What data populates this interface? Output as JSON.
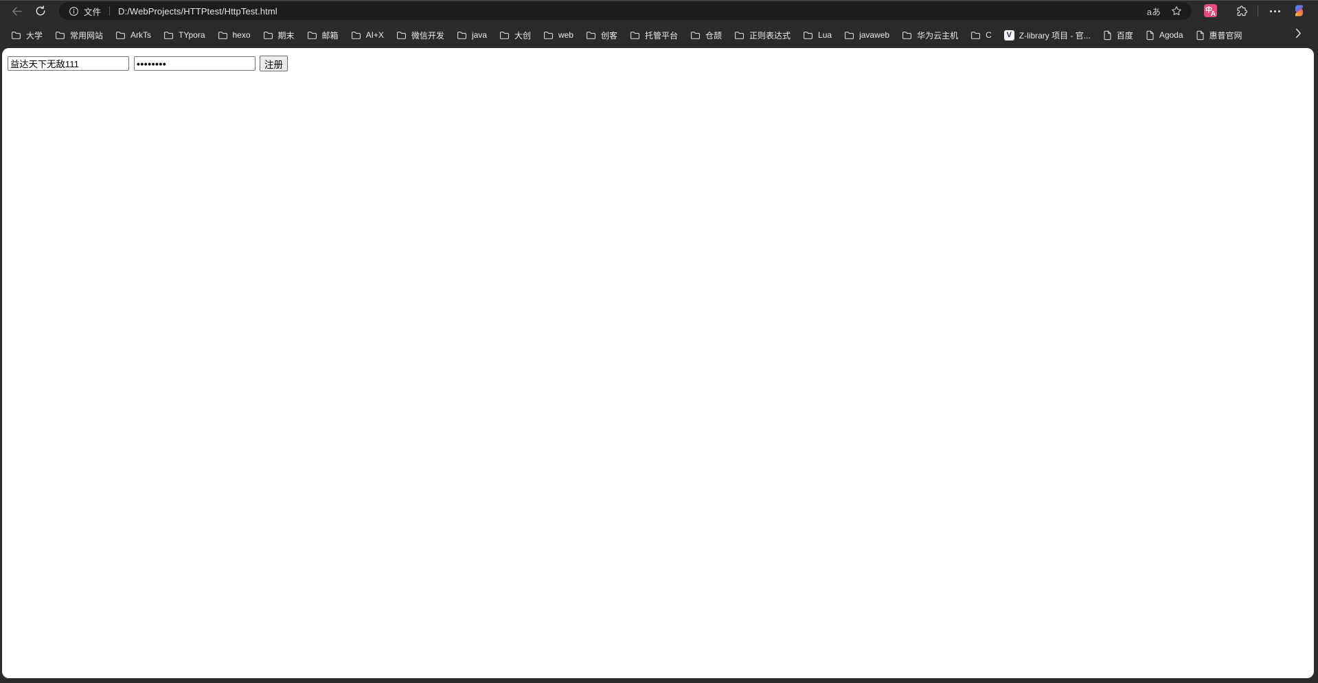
{
  "chrome": {
    "toolbar": {
      "site_button_label": "文件",
      "url": "D:/WebProjects/HTTPtest/HttpTest.html",
      "font_toggle_glyph": "aあ"
    },
    "extensions": {
      "translate_badge_top": "中",
      "translate_badge_bottom": "A"
    },
    "zlibrary_favicon_letter": "V",
    "bookmarks": [
      {
        "label": "大学",
        "icon": "folder"
      },
      {
        "label": "常用网站",
        "icon": "folder"
      },
      {
        "label": "ArkTs",
        "icon": "folder"
      },
      {
        "label": "TYpora",
        "icon": "folder"
      },
      {
        "label": "hexo",
        "icon": "folder"
      },
      {
        "label": "期末",
        "icon": "folder"
      },
      {
        "label": "邮箱",
        "icon": "folder"
      },
      {
        "label": "AI+X",
        "icon": "folder"
      },
      {
        "label": "微信开发",
        "icon": "folder"
      },
      {
        "label": "java",
        "icon": "folder"
      },
      {
        "label": "大创",
        "icon": "folder"
      },
      {
        "label": "web",
        "icon": "folder"
      },
      {
        "label": "创客",
        "icon": "folder"
      },
      {
        "label": "托管平台",
        "icon": "folder"
      },
      {
        "label": "仓颉",
        "icon": "folder"
      },
      {
        "label": "正则表达式",
        "icon": "folder"
      },
      {
        "label": "Lua",
        "icon": "folder"
      },
      {
        "label": "javaweb",
        "icon": "folder"
      },
      {
        "label": "华为云主机",
        "icon": "folder"
      },
      {
        "label": "C",
        "icon": "folder"
      },
      {
        "label": "Z-library 项目 - 官...",
        "icon": "zlibrary"
      },
      {
        "label": "百度",
        "icon": "page"
      },
      {
        "label": "Agoda",
        "icon": "page"
      },
      {
        "label": "惠普官网",
        "icon": "page"
      }
    ]
  },
  "page": {
    "username_input": {
      "value": "益达天下无敌111"
    },
    "password_input": {
      "value": "••••••••"
    },
    "register_button_label": "注册"
  },
  "colors": {
    "chrome_bg": "#2b2b2b",
    "address_pill_bg": "#1d1d1d",
    "chrome_text": "#e8e8e8",
    "translate_badge_pink": "#e34d7e",
    "page_bg": "#ffffff",
    "input_border": "#767676",
    "button_bg": "#ececec"
  }
}
